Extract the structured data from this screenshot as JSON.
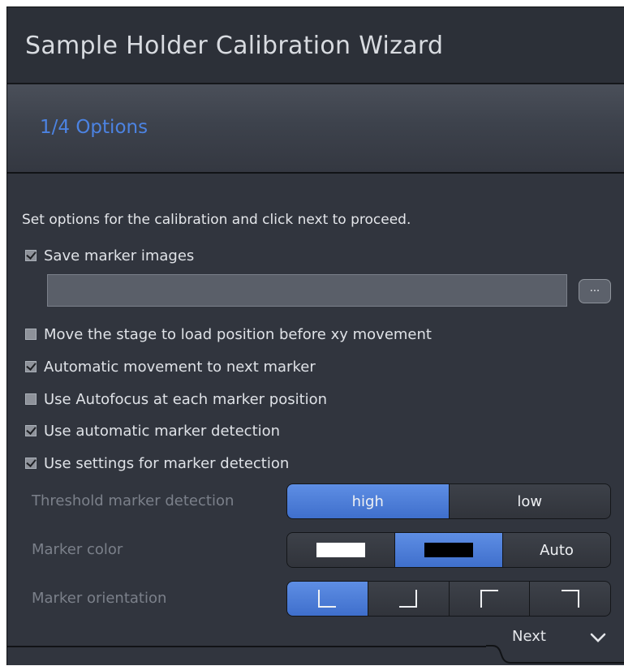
{
  "window": {
    "title": "Sample Holder Calibration Wizard"
  },
  "step": {
    "label": "1/4  Options"
  },
  "instruction": "Set options for the calibration and click next to proceed.",
  "options": [
    {
      "label": "Save marker images",
      "checked": true
    },
    {
      "label": "Move the stage to load position before xy movement",
      "checked": false
    },
    {
      "label": "Automatic movement to next marker",
      "checked": true
    },
    {
      "label": "Use Autofocus at each marker position",
      "checked": false
    },
    {
      "label": "Use automatic marker detection",
      "checked": true
    },
    {
      "label": "Use settings for marker detection",
      "checked": true
    }
  ],
  "path_field": {
    "value": ""
  },
  "browse_button": {
    "label": "..."
  },
  "threshold": {
    "label": "Threshold marker detection",
    "options": [
      "high",
      "low"
    ],
    "selected": "high"
  },
  "marker_color": {
    "label": "Marker color",
    "options": [
      "white",
      "black",
      "Auto"
    ],
    "auto_label": "Auto",
    "selected": "black"
  },
  "marker_orientation": {
    "label": "Marker orientation",
    "options": [
      "bottom-left",
      "bottom-right",
      "top-left",
      "top-right"
    ],
    "selected": "bottom-left"
  },
  "footer": {
    "next_label": "Next"
  },
  "colors": {
    "accent": "#4a7fdc",
    "background": "#31353e",
    "text": "#dfe2e7",
    "muted_text": "#7b808a"
  }
}
